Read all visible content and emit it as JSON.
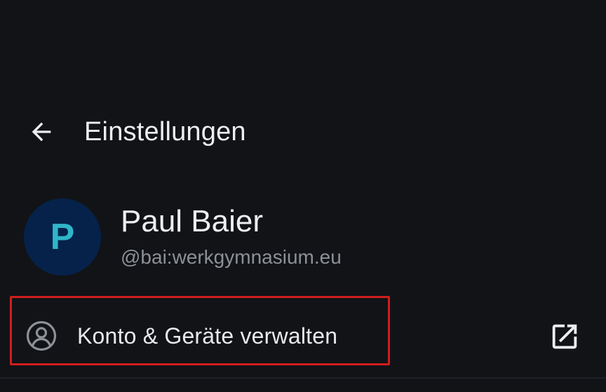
{
  "header": {
    "title": "Einstellungen",
    "back_icon": "arrow-left-icon"
  },
  "profile": {
    "avatar_letter": "P",
    "display_name": "Paul Baier",
    "user_id": "@bai:werkgymnasium.eu",
    "avatar_bg": "#06224a",
    "avatar_fg": "#2fb5c9"
  },
  "account_item": {
    "label": "Konto & Geräte verwalten",
    "icon": "account-circle-icon",
    "trailing_icon": "open-external-icon",
    "highlight_color": "#d11d1d"
  }
}
